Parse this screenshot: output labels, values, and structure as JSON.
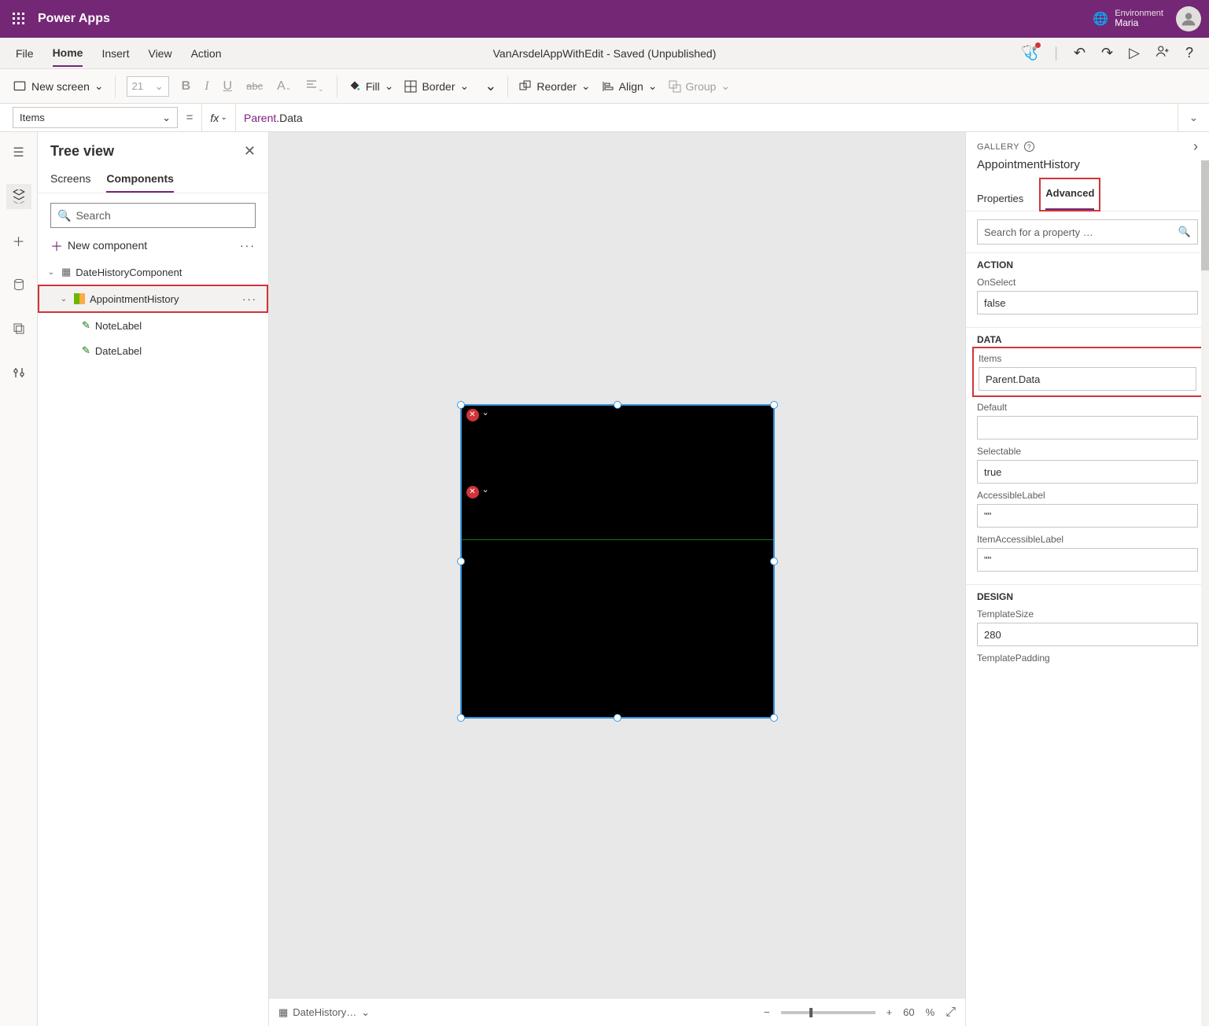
{
  "header": {
    "brand": "Power Apps",
    "env_label": "Environment",
    "env_name": "Maria"
  },
  "menu": {
    "items": [
      "File",
      "Home",
      "Insert",
      "View",
      "Action"
    ],
    "center": "VanArsdelAppWithEdit - Saved (Unpublished)"
  },
  "toolbar": {
    "newscreen": "New screen",
    "font_size": "21",
    "fill": "Fill",
    "border": "Border",
    "reorder": "Reorder",
    "align": "Align",
    "group": "Group"
  },
  "fx": {
    "property": "Items",
    "formula_parent": "Parent",
    "formula_rest": ".Data"
  },
  "tree": {
    "title": "Tree view",
    "tab_screens": "Screens",
    "tab_components": "Components",
    "search_placeholder": "Search",
    "new_component": "New component",
    "root": "DateHistoryComponent",
    "sel": "AppointmentHistory",
    "child1": "NoteLabel",
    "child2": "DateLabel"
  },
  "canvas_footer": {
    "name": "DateHistory…",
    "zoom": "60",
    "pct": "%"
  },
  "right": {
    "type": "GALLERY",
    "title": "AppointmentHistory",
    "tab_props": "Properties",
    "tab_adv": "Advanced",
    "search_placeholder": "Search for a property …",
    "sec_action": "ACTION",
    "onselect_label": "OnSelect",
    "onselect_val": "false",
    "sec_data": "DATA",
    "items_label": "Items",
    "items_val": "Parent.Data",
    "default_label": "Default",
    "default_val": "",
    "selectable_label": "Selectable",
    "selectable_val": "true",
    "al_label": "AccessibleLabel",
    "al_val": "\"\"",
    "ial_label": "ItemAccessibleLabel",
    "ial_val": "\"\"",
    "sec_design": "DESIGN",
    "ts_label": "TemplateSize",
    "ts_val": "280",
    "tp_label": "TemplatePadding"
  }
}
